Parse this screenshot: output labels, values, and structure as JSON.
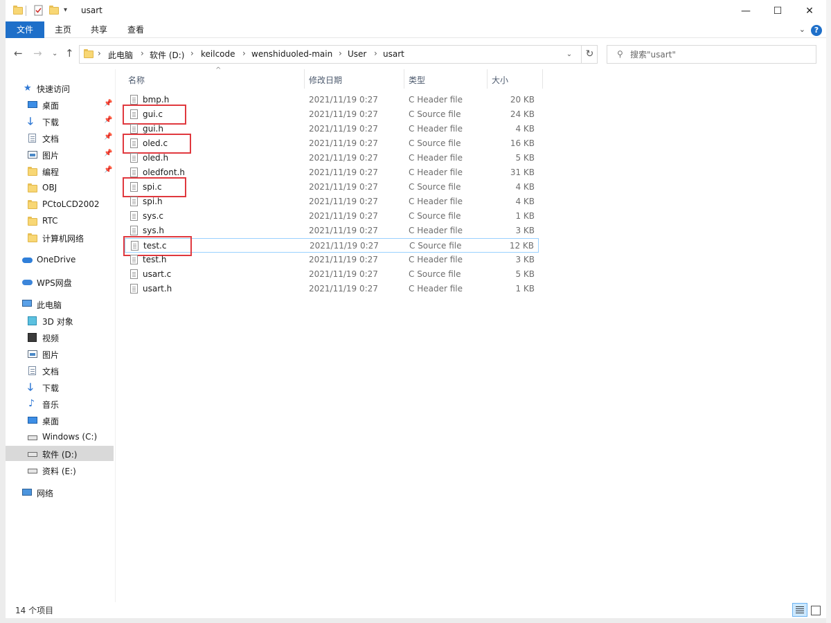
{
  "window": {
    "title": "usart",
    "controls": {
      "minimize": "—",
      "maximize": "☐",
      "close": "✕"
    }
  },
  "ribbon": {
    "tabs": [
      "文件",
      "主页",
      "共享",
      "查看"
    ],
    "help": "?"
  },
  "address": {
    "breadcrumbs": [
      "此电脑",
      "软件 (D:)",
      "keilcode",
      "wenshiduoled-main",
      "User",
      "usart"
    ],
    "separator": "›"
  },
  "search": {
    "placeholder": "搜索\"usart\""
  },
  "sidebar": {
    "quick_access": {
      "label": "快速访问",
      "items": [
        {
          "label": "桌面",
          "pinned": true
        },
        {
          "label": "下载",
          "pinned": true
        },
        {
          "label": "文档",
          "pinned": true
        },
        {
          "label": "图片",
          "pinned": true
        },
        {
          "label": "编程",
          "pinned": true
        },
        {
          "label": "OBJ",
          "pinned": false
        },
        {
          "label": "PCtoLCD2002",
          "pinned": false
        },
        {
          "label": "RTC",
          "pinned": false
        },
        {
          "label": "计算机网络",
          "pinned": false
        }
      ]
    },
    "onedrive": "OneDrive",
    "wps": "WPS网盘",
    "this_pc": {
      "label": "此电脑",
      "items": [
        "3D 对象",
        "视频",
        "图片",
        "文档",
        "下载",
        "音乐",
        "桌面",
        "Windows (C:)",
        "软件 (D:)",
        "资料 (E:)"
      ]
    },
    "network": "网络",
    "selected": "软件 (D:)"
  },
  "columns": {
    "name": "名称",
    "date": "修改日期",
    "type": "类型",
    "size": "大小"
  },
  "files": [
    {
      "name": "bmp.h",
      "date": "2021/11/19 0:27",
      "type": "C Header file",
      "size": "20 KB",
      "highlighted": false
    },
    {
      "name": "gui.c",
      "date": "2021/11/19 0:27",
      "type": "C Source file",
      "size": "24 KB",
      "highlighted": true
    },
    {
      "name": "gui.h",
      "date": "2021/11/19 0:27",
      "type": "C Header file",
      "size": "4 KB",
      "highlighted": false
    },
    {
      "name": "oled.c",
      "date": "2021/11/19 0:27",
      "type": "C Source file",
      "size": "16 KB",
      "highlighted": true
    },
    {
      "name": "oled.h",
      "date": "2021/11/19 0:27",
      "type": "C Header file",
      "size": "5 KB",
      "highlighted": false
    },
    {
      "name": "oledfont.h",
      "date": "2021/11/19 0:27",
      "type": "C Header file",
      "size": "31 KB",
      "highlighted": false
    },
    {
      "name": "spi.c",
      "date": "2021/11/19 0:27",
      "type": "C Source file",
      "size": "4 KB",
      "highlighted": true
    },
    {
      "name": "spi.h",
      "date": "2021/11/19 0:27",
      "type": "C Header file",
      "size": "4 KB",
      "highlighted": false
    },
    {
      "name": "sys.c",
      "date": "2021/11/19 0:27",
      "type": "C Source file",
      "size": "1 KB",
      "highlighted": false
    },
    {
      "name": "sys.h",
      "date": "2021/11/19 0:27",
      "type": "C Header file",
      "size": "3 KB",
      "highlighted": false
    },
    {
      "name": "test.c",
      "date": "2021/11/19 0:27",
      "type": "C Source file",
      "size": "12 KB",
      "highlighted": true
    },
    {
      "name": "test.h",
      "date": "2021/11/19 0:27",
      "type": "C Header file",
      "size": "3 KB",
      "highlighted": false
    },
    {
      "name": "usart.c",
      "date": "2021/11/19 0:27",
      "type": "C Source file",
      "size": "5 KB",
      "highlighted": false
    },
    {
      "name": "usart.h",
      "date": "2021/11/19 0:27",
      "type": "C Header file",
      "size": "1 KB",
      "highlighted": false
    }
  ],
  "hovered_file": "test.c",
  "status": {
    "item_count": "14 个项目"
  },
  "colors": {
    "accent": "#1e6fc9",
    "highlight_box": "#e0383e",
    "hover_border": "#99d1ff",
    "selected_nav": "#d9d9d9"
  }
}
